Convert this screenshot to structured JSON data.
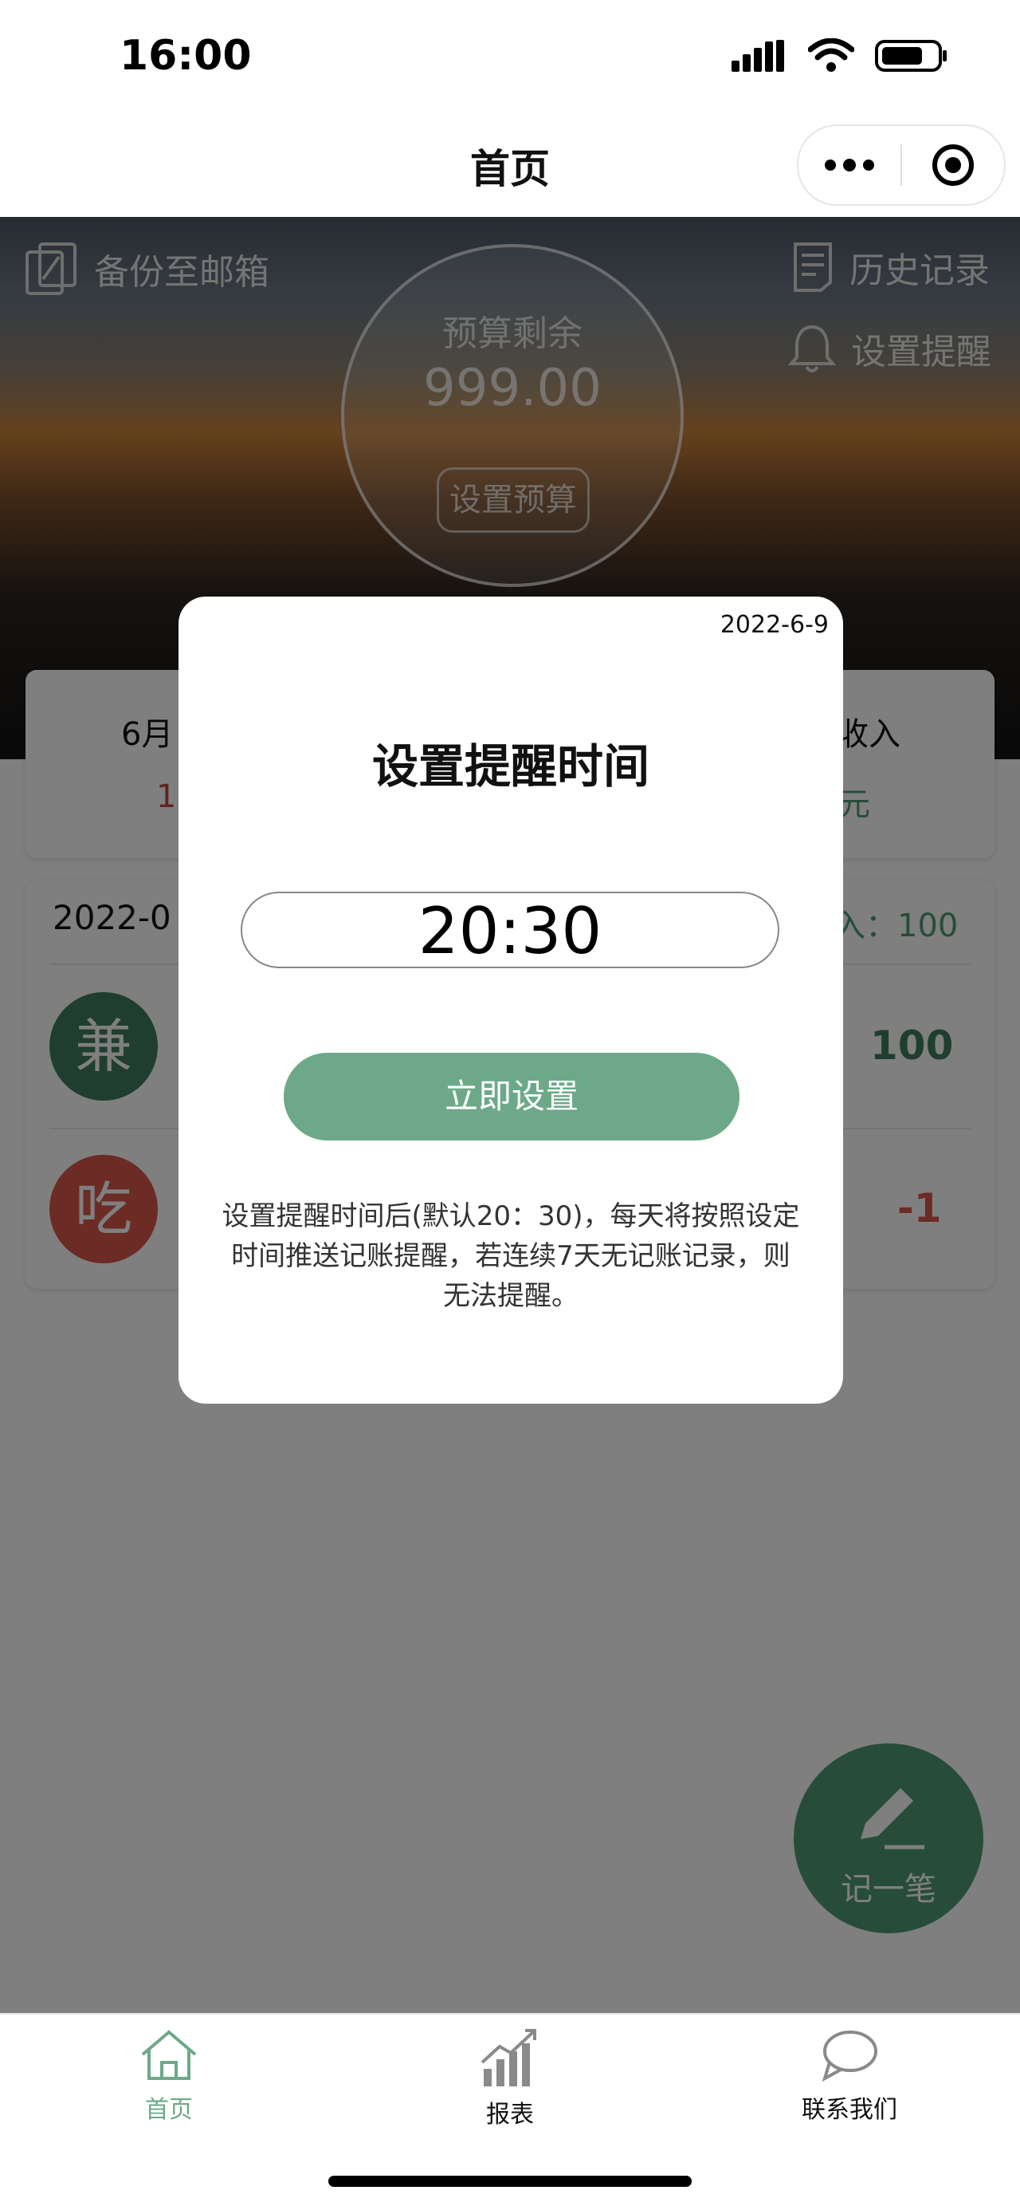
{
  "status_bar": {
    "time": "16:00"
  },
  "nav": {
    "title": "首页"
  },
  "header": {
    "backup_label": "备份至邮箱",
    "history_label": "历史记录",
    "reminder_label": "设置提醒",
    "budget_label": "预算剩余",
    "budget_value": "999.00",
    "set_budget_label": "设置预算"
  },
  "summary": {
    "month_label": "6月",
    "expense_value_visible": "1",
    "income_label": "收入",
    "income_value_visible": "元"
  },
  "day_list": {
    "date": "2022-0",
    "income_text": "入：100",
    "entries": [
      {
        "category": "兼",
        "amount": "100",
        "color": "#3f7d5f"
      },
      {
        "category": "吃",
        "amount": "-1",
        "color": "#d9574a"
      }
    ]
  },
  "fab": {
    "label": "记一笔"
  },
  "modal": {
    "date": "2022-6-9",
    "title": "设置提醒时间",
    "time_value": "20:30",
    "confirm_label": "立即设置",
    "description": "设置提醒时间后(默认20：30)，每天将按照设定时间推送记账提醒，若连续7天无记账记录，则无法提醒。"
  },
  "tabbar": {
    "items": [
      {
        "label": "首页",
        "active": true
      },
      {
        "label": "报表",
        "active": false
      },
      {
        "label": "联系我们",
        "active": false
      }
    ]
  },
  "colors": {
    "accent": "#4e9a74",
    "expense": "#d9574a",
    "button": "#6da988"
  }
}
